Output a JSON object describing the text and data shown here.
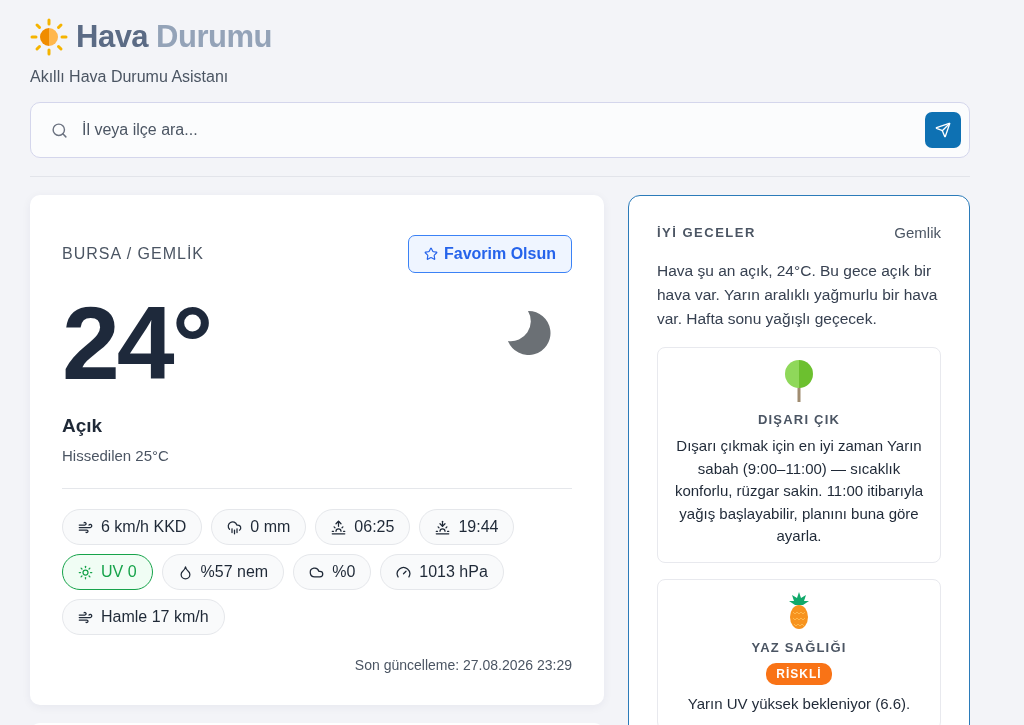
{
  "header": {
    "title_primary": "Hava",
    "title_secondary": "Durumu",
    "subtitle": "Akıllı Hava Durumu Asistanı"
  },
  "search": {
    "placeholder": "İl veya ilçe ara..."
  },
  "current": {
    "location": "BURSA / GEMLİK",
    "favorite_button": "Favorim Olsun",
    "temperature": "24°",
    "condition": "Açık",
    "feels_like": "Hissedilen 25°C",
    "chips": [
      {
        "kind": "wind",
        "label": "6 km/h KKD"
      },
      {
        "kind": "rain",
        "label": "0 mm"
      },
      {
        "kind": "sunrise",
        "label": "06:25"
      },
      {
        "kind": "sunset",
        "label": "19:44"
      },
      {
        "kind": "uv",
        "label": "UV 0",
        "color": "#16a34a"
      },
      {
        "kind": "humidity",
        "label": "%57 nem"
      },
      {
        "kind": "cloud",
        "label": "%0"
      },
      {
        "kind": "pressure",
        "label": "1013 hPa"
      },
      {
        "kind": "wind",
        "label": "Hamle 17 km/h"
      }
    ],
    "updated": "Son güncelleme: 27.08.2026 23:29"
  },
  "assistant": {
    "greeting": "İYİ GECELER",
    "location": "Gemlik",
    "summary": "Hava şu an açık, 24°C. Bu gece açık bir hava var. Yarın aralıklı yağmurlu bir hava var. Hafta sonu yağışlı geçecek.",
    "tips": [
      {
        "kind": "tree",
        "title": "DIŞARI ÇIK",
        "text": "Dışarı çıkmak için en iyi zaman Yarın sabah (9:00–11:00) — sıcaklık konforlu, rüzgar sakin. 11:00 itibarıyla yağış başlayabilir, planını buna göre ayarla."
      },
      {
        "kind": "pineapple",
        "title": "YAZ SAĞLIĞI",
        "badge": "RİSKLİ",
        "text": "Yarın UV yüksek bekleniyor (6.6)."
      }
    ]
  }
}
